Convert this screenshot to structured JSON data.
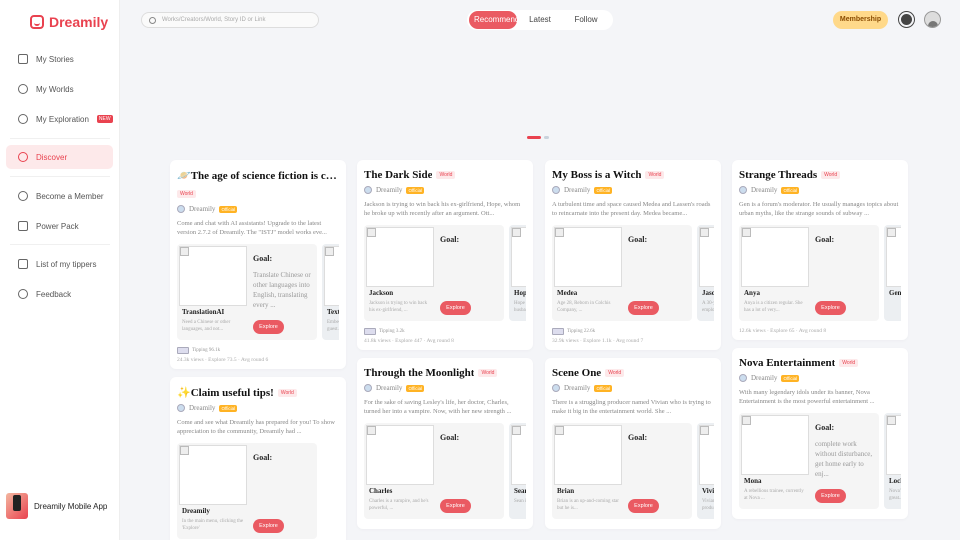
{
  "app": {
    "name": "Dreamily"
  },
  "sidebar": {
    "items": [
      {
        "label": "My Stories",
        "icon": "book-icon"
      },
      {
        "label": "My Worlds",
        "icon": "globe-icon"
      },
      {
        "label": "My Exploration",
        "icon": "compass-icon",
        "badge": "NEW"
      },
      {
        "label": "Discover",
        "icon": "discover-icon"
      },
      {
        "label": "Become a Member",
        "icon": "crown-icon"
      },
      {
        "label": "Power Pack",
        "icon": "power-icon"
      },
      {
        "label": "List of my tippers",
        "icon": "list-icon"
      },
      {
        "label": "Feedback",
        "icon": "feedback-icon"
      }
    ],
    "app_promo": "Dreamily Mobile App"
  },
  "header": {
    "search_placeholder": "Works/Creators/World, Story ID or Link",
    "tabs": [
      "Recommend",
      "Latest",
      "Follow"
    ],
    "membership": "Membership"
  },
  "columns": [
    [
      {
        "title": "🪐The age of science fiction is comi...",
        "tag": "World",
        "author": "Dreamily",
        "official": "Official",
        "desc": "Come and chat with AI assistants! Upgrade to the latest version 2.7.2 of Dreamily. The \"ISTJ\" model works eve...",
        "chars": [
          {
            "name": "TranslationAI",
            "desc": "Need a Chinese or other languages, and not...",
            "goal": "Translate Chinese or other languages into English, translating every ...",
            "btn": "Explore"
          },
          {
            "name": "TextA",
            "desc": "Embed... guest... word..."
          }
        ],
        "tipping": "Tipping 96.1k",
        "stats": "24.3k views · Explore 73.5 · Avg round 6"
      },
      {
        "title": "✨Claim useful tips!",
        "tag": "World",
        "author": "Dreamily",
        "official": "Official",
        "desc": "Come and see what Dreamily has prepared for you! To show appreciation to the community, Dreamily had ...",
        "chars": [
          {
            "name": "Dreamily",
            "desc": "In the main menu, clicking the 'Explore'",
            "goal": "",
            "btn": "Explore"
          }
        ]
      }
    ],
    [
      {
        "title": "The Dark Side",
        "tag": "World",
        "author": "Dreamily",
        "official": "Official",
        "desc": "Jackson is trying to win back his ex-girlfriend, Hope, whom he broke up with recently after an argument. Ott...",
        "chars": [
          {
            "name": "Jackson",
            "desc": "Jackson is trying to win back his ex-girlfriend, ...",
            "goal": "",
            "btn": "Explore"
          },
          {
            "name": "Hope",
            "desc": "Hope n... husba..."
          }
        ],
        "tipping": "Tipping 3.2k",
        "stats": "41.8k views · Explore 447 · Avg round 8"
      },
      {
        "title": "Through the Moonlight",
        "tag": "World",
        "author": "Dreamily",
        "official": "Official",
        "desc": "For the sake of saving Lesley's life, her doctor, Charles, turned her into a vampire. Now, with her new strength ...",
        "chars": [
          {
            "name": "Charles",
            "desc": "Charles is a vampire, and he's powerful, ...",
            "goal": "",
            "btn": "Explore"
          },
          {
            "name": "Sean",
            "desc": "Sean is... you..."
          }
        ]
      }
    ],
    [
      {
        "title": "My Boss is a Witch",
        "tag": "World",
        "author": "Dreamily",
        "official": "Official",
        "desc": "A turbulent time and space caused Medea and Lassen's roads to reincarnate into the present day. Medea became...",
        "chars": [
          {
            "name": "Medea",
            "desc": "Age 28, Reborn in Colchis Company, ...",
            "goal": "",
            "btn": "Explore"
          },
          {
            "name": "Jason",
            "desc": "A 30-y... employ..."
          }
        ],
        "tipping": "Tipping 22.6k",
        "stats": "32.9k views · Explore 1.1k · Avg round 7"
      },
      {
        "title": "Scene One",
        "tag": "World",
        "author": "Dreamily",
        "official": "Official",
        "desc": "There is a struggling producer named Vivian who is trying to make it big in the entertainment world. She ...",
        "chars": [
          {
            "name": "Brian",
            "desc": "Brian is an up-and-coming star but he is...",
            "goal": "",
            "btn": "Explore"
          },
          {
            "name": "Vivian",
            "desc": "Vivian... produ..."
          }
        ]
      }
    ],
    [
      {
        "title": "Strange Threads",
        "tag": "World",
        "author": "Dreamily",
        "official": "Official",
        "desc": "Gen is a forum's moderator. He usually manages topics about urban myths, like the strange sounds of subway ...",
        "chars": [
          {
            "name": "Anya",
            "desc": "Anya is a citizen regular. She has a lot of very...",
            "goal": "",
            "btn": "Explore"
          },
          {
            "name": "Gen",
            "desc": ""
          }
        ],
        "stats": "12.6k views · Explore 65 · Avg round 8"
      },
      {
        "title": "Nova Entertainment",
        "tag": "World",
        "author": "Dreamily",
        "official": "Official",
        "desc": "With many legendary idols under its banner, Nova Entertainment is the most powerful entertainment ...",
        "chars": [
          {
            "name": "Mona",
            "desc": "A rebellious trainee, currently at Nova ...",
            "goal": "complete work without disturbance, get home early to enj...",
            "btn": "Explore"
          },
          {
            "name": "Loch",
            "desc": "Nova's... great..."
          }
        ]
      }
    ]
  ]
}
